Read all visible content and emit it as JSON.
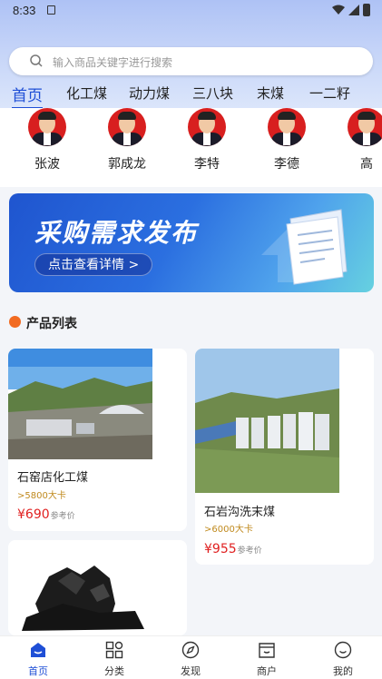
{
  "status_bar": {
    "time": "8:33"
  },
  "search": {
    "placeholder": "输入商品关键字进行搜索"
  },
  "categories": [
    "首页",
    "化工煤",
    "动力煤",
    "三八块",
    "末煤",
    "一二籽"
  ],
  "people": [
    "张波",
    "郭成龙",
    "李特",
    "李德",
    "高"
  ],
  "banner": {
    "title": "采购需求发布",
    "cta": "点击查看详情 >"
  },
  "section": {
    "title": "产品列表"
  },
  "products": [
    {
      "name": "石窑店化工煤",
      "spec": ">5800大卡",
      "price": "¥690",
      "price_note": "参考价"
    },
    {
      "name": "石岩沟洗末煤",
      "spec": ">6000大卡",
      "price": "¥955",
      "price_note": "参考价"
    }
  ],
  "bottom_nav": [
    "首页",
    "分类",
    "发现",
    "商户",
    "我的"
  ],
  "colors": {
    "accent": "#1f4fd6",
    "price": "#e02020",
    "spec": "#c08a1e"
  }
}
